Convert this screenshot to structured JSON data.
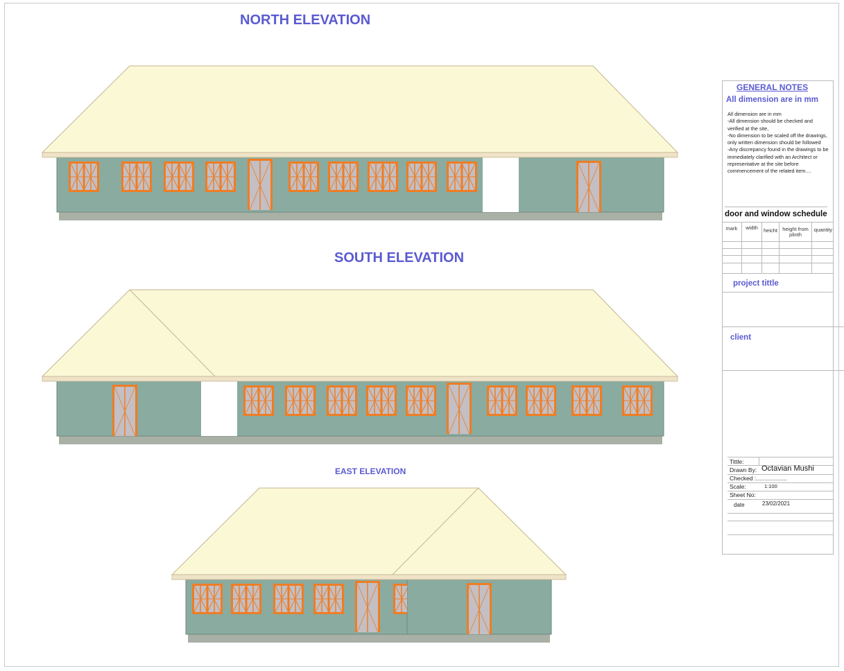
{
  "titles": {
    "north": "NORTH ELEVATION",
    "south": "SOUTH ELEVATION",
    "east": "EAST ELEVATION"
  },
  "colors": {
    "roof": "#fbf8d6",
    "roof_edge": "#c4b491",
    "fascia": "#efe3c7",
    "wall": "#8aab9f",
    "wall_edge": "#6f8a80",
    "plinth": "#a9b0a6",
    "frame": "#ef7d24",
    "glass": "#c3bfc4",
    "title_blue": "#5a5ad2"
  },
  "notes": {
    "heading": "GENERAL NOTES",
    "subheading": "All dimension are in mm",
    "lines": [
      "All dimension are in mm",
      "-All dimension should be checked and verified at the site,",
      "-No dimension to be scaled off the drawings, only written dimension should be followed",
      "-Any discrepancy found in the drawings to be immediately clarified with an Architect or representative at the site before commencement of the related item...."
    ]
  },
  "schedule": {
    "title": "door and window schedule",
    "columns": [
      "mark",
      "width",
      "heicht",
      "height from plinth",
      "quantity"
    ]
  },
  "project": {
    "title_label": "project tittle",
    "client_label": "client"
  },
  "title_block": {
    "title_label": "Tittle:",
    "drawn_label": "Drawn By:",
    "drawn_value": "Octavian Mushi",
    "checked_label": "Checked :...................",
    "scale_label": "Scale:",
    "scale_value": "1:100",
    "sheet_label": "Sheet No:",
    "date_label": "date",
    "date_value": "23/02/2021"
  }
}
